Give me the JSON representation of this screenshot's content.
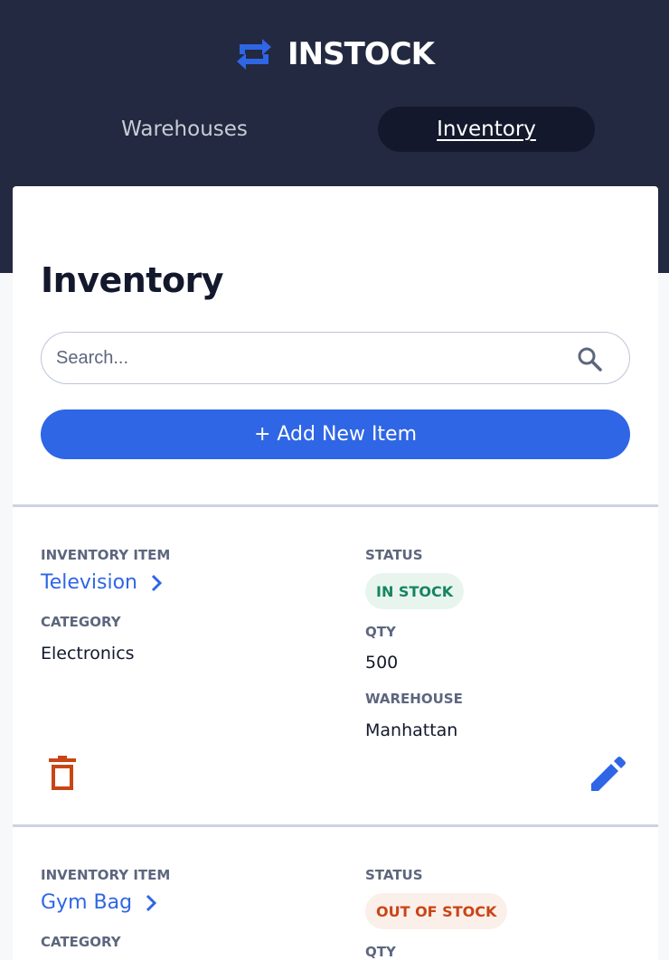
{
  "brand": {
    "name": "INSTOCK",
    "logo_icon": "swap-arrows-icon",
    "color": "#2E66E5"
  },
  "nav": {
    "warehouses": "Warehouses",
    "inventory": "Inventory",
    "active": "Inventory"
  },
  "page": {
    "title": "Inventory"
  },
  "search": {
    "placeholder": "Search...",
    "icon": "search-icon"
  },
  "add_button": {
    "label": "+ Add New Item"
  },
  "labels": {
    "inventory_item": "INVENTORY ITEM",
    "category": "CATEGORY",
    "status": "STATUS",
    "qty": "QTY",
    "warehouse": "WAREHOUSE"
  },
  "items": [
    {
      "name": "Television",
      "category": "Electronics",
      "status": "IN STOCK",
      "qty": "500",
      "warehouse": "Manhattan"
    },
    {
      "name": "Gym Bag",
      "status": "OUT OF STOCK"
    }
  ],
  "colors": {
    "header_bg": "#232940",
    "accent": "#2E66E5",
    "in_stock": "#158463",
    "out_of_stock": "#C94515",
    "delete": "#C94515"
  }
}
